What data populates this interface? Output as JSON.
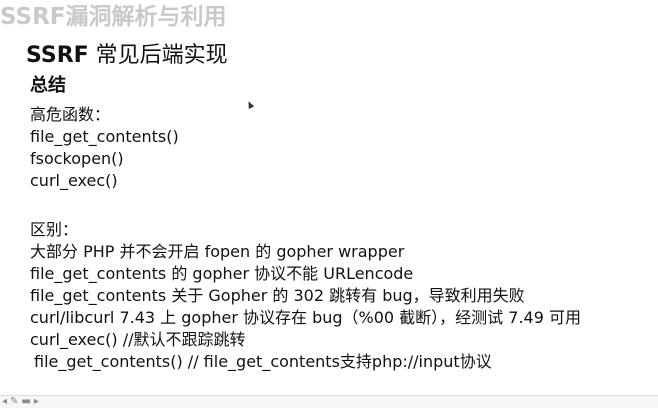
{
  "slide": {
    "title": "SSRF漏洞解析与利用",
    "subtitle_bold": "SSRF",
    "subtitle_rest": " 常见后端实现"
  },
  "summary": {
    "heading": "总结",
    "risky_label": "高危函数：",
    "functions": [
      "file_get_contents()",
      "fsockopen()",
      "curl_exec()"
    ]
  },
  "differences": {
    "label": "区别：",
    "items": [
      "大部分 PHP 并不会开启 fopen 的 gopher wrapper",
      "file_get_contents 的 gopher 协议不能 URLencode",
      "file_get_contents 关于 Gopher 的 302 跳转有 bug，导致利用失败",
      "curl/libcurl 7.43 上 gopher 协议存在 bug（%00 截断），经测试 7.49 可用",
      "curl_exec() //默认不跟踪跳转",
      "file_get_contents() // file_get_contents支持php://input协议"
    ]
  },
  "nav": {
    "prev_icon": "◂",
    "pen_icon": "✎",
    "menu_icon": "▬",
    "next_icon": "▸"
  }
}
